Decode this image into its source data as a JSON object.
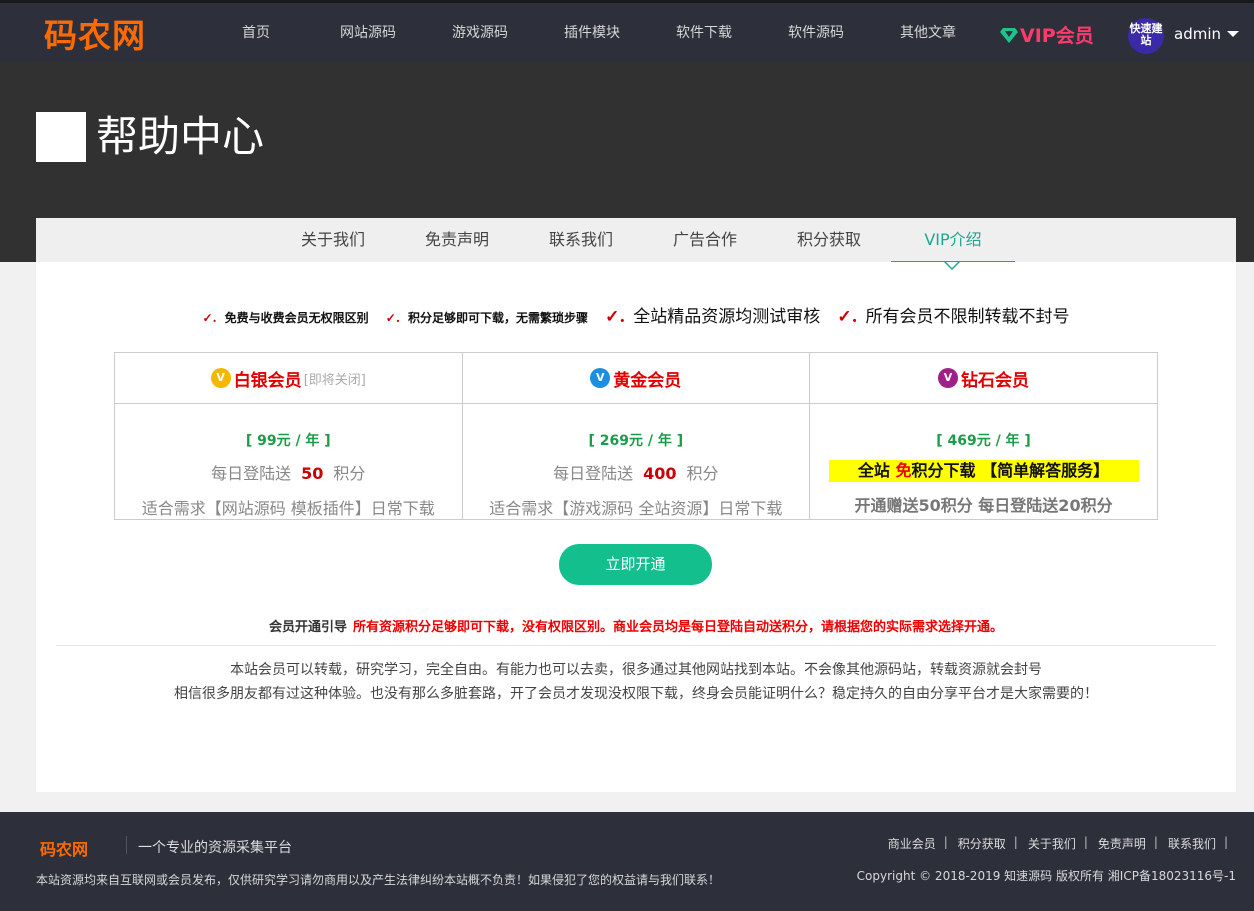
{
  "header": {
    "logo": "码农网",
    "nav": [
      "首页",
      "网站源码",
      "游戏源码",
      "插件模块",
      "软件下载",
      "软件源码",
      "其他文章"
    ],
    "vip_label": "VIP会员",
    "avatar_text": "快速建站",
    "username": "admin"
  },
  "hero": {
    "title": "帮助中心"
  },
  "tabs": [
    "关于我们",
    "免责声明",
    "联系我们",
    "广告合作",
    "积分获取",
    "VIP介绍"
  ],
  "active_tab": "VIP介绍",
  "features": [
    {
      "check": "✓.",
      "text": "免费与收费会员无权限区别"
    },
    {
      "check": "✓.",
      "text": "积分足够即可下载，无需繁琐步骤"
    },
    {
      "check": "✓.",
      "text": "全站精品资源均测试审核"
    },
    {
      "check": "✓.",
      "text": "所有会员不限制转载不封号"
    }
  ],
  "plans": [
    {
      "name": "白银会员",
      "note": "[即将关闭]",
      "color": "#e00000",
      "icon_color": "#f5b800",
      "price": "[ 99元 / 年 ]",
      "daily_prefix": "每日登陆送",
      "daily_points": "50",
      "daily_suffix": "积分",
      "suit": "适合需求【网站源码 模板插件】日常下载"
    },
    {
      "name": "黄金会员",
      "note": "",
      "color": "#e00000",
      "icon_color": "#1c8fe0",
      "price": "[ 269元 / 年 ]",
      "daily_prefix": "每日登陆送",
      "daily_points": "400",
      "daily_suffix": "积分",
      "suit": "适合需求【游戏源码 全站资源】日常下载"
    },
    {
      "name": "钻石会员",
      "note": "",
      "color": "#e00000",
      "icon_color": "#a0208a",
      "price": "[ 469元 / 年 ]",
      "highlight_a": "全站 ",
      "highlight_free": "免",
      "highlight_b": "积分下载 【简单解答服务】",
      "bonus": "开通赠送50积分 每日登陆送20积分"
    }
  ],
  "open_button": "立即开通",
  "guide": {
    "label": "会员开通引导",
    "text": "所有资源积分足够即可下载，没有权限区别。商业会员均是每日登陆自动送积分，请根据您的实际需求选择开通。"
  },
  "paragraph": [
    "本站会员可以转载，研究学习，完全自由。有能力也可以去卖，很多通过其他网站找到本站。不会像其他源码站，转载资源就会封号",
    "相信很多朋友都有过这种体验。也没有那么多脏套路，开了会员才发现没权限下载，终身会员能证明什么？稳定持久的自由分享平台才是大家需要的！"
  ],
  "footer": {
    "logo": "码农网",
    "slogan": "一个专业的资源采集平台",
    "note": "本站资源均来自互联网或会员发布，仅供研究学习请勿商用以及产生法律纠纷本站概不负责！如果侵犯了您的权益请与我们联系！",
    "links": [
      "商业会员",
      "积分获取",
      "关于我们",
      "免责声明",
      "联系我们"
    ],
    "copyright": "Copyright © 2018-2019 知速源码 版权所有 湘ICP备18023116号-1"
  }
}
